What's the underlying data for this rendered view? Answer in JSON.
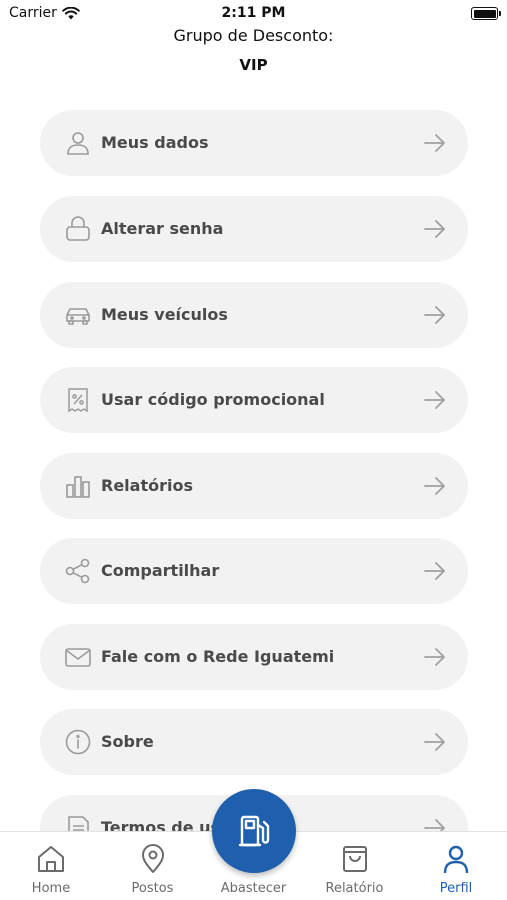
{
  "status_bar": {
    "carrier": "Carrier",
    "time": "2:11 PM"
  },
  "group": {
    "title": "Grupo de Desconto:",
    "value": "VIP"
  },
  "menu": {
    "items": [
      {
        "label": "Meus dados",
        "icon": "user-icon"
      },
      {
        "label": "Alterar senha",
        "icon": "lock-icon"
      },
      {
        "label": "Meus veículos",
        "icon": "car-icon"
      },
      {
        "label": "Usar código promocional",
        "icon": "coupon-icon"
      },
      {
        "label": "Relatórios",
        "icon": "bar-chart-icon"
      },
      {
        "label": "Compartilhar",
        "icon": "share-icon"
      },
      {
        "label": "Fale com o Rede Iguatemi",
        "icon": "mail-icon"
      },
      {
        "label": "Sobre",
        "icon": "info-icon"
      },
      {
        "label": "Termos de uso",
        "icon": "document-icon"
      }
    ]
  },
  "tab_bar": {
    "tabs": [
      {
        "label": "Home",
        "icon": "home-icon"
      },
      {
        "label": "Postos",
        "icon": "location-pin-icon"
      },
      {
        "label": "Abastecer",
        "icon": "fuel-pump-icon"
      },
      {
        "label": "Relatório",
        "icon": "shopping-bag-icon"
      },
      {
        "label": "Perfil",
        "icon": "user-icon",
        "active": true
      }
    ]
  },
  "colors": {
    "accent": "#1e5fae",
    "item_bg": "#f2f2f2",
    "text": "#4a4a4a",
    "icon": "#9a9a9a"
  }
}
